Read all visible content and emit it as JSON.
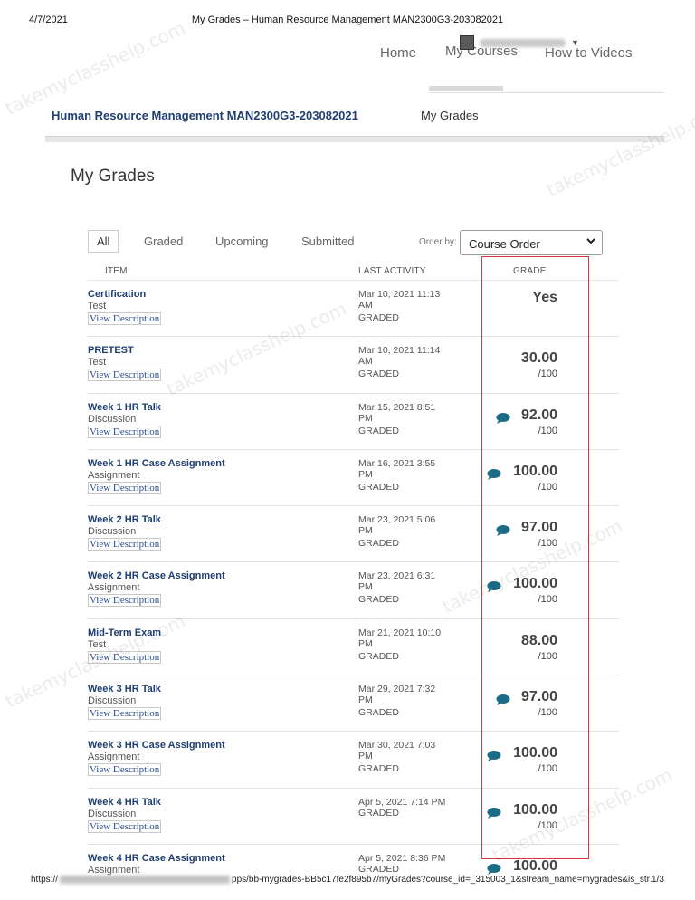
{
  "print_header": {
    "date": "4/7/2021",
    "title": "My Grades – Human Resource Management MAN2300G3-203082021"
  },
  "topnav": {
    "home": "Home",
    "my_courses": "My Courses",
    "how_to_videos": "How to Videos"
  },
  "course": {
    "title": "Human Resource Management MAN2300G3-203082021",
    "breadcrumb": "My Grades"
  },
  "page_title": "My Grades",
  "filters": {
    "all": "All",
    "graded": "Graded",
    "upcoming": "Upcoming",
    "submitted": "Submitted"
  },
  "order_by": {
    "label": "Order by:",
    "selected": "Course Order"
  },
  "columns": {
    "item": "ITEM",
    "last_activity": "LAST ACTIVITY",
    "grade": "GRADE"
  },
  "view_description_label": "View Description",
  "rows": [
    {
      "name": "Certification",
      "type": "Test",
      "date_line1": "Mar 10, 2021 11:13",
      "date_line2": "AM",
      "status": "GRADED",
      "grade": "Yes",
      "max": "",
      "comment": false
    },
    {
      "name": "PRETEST",
      "type": "Test",
      "date_line1": "Mar 10, 2021 11:14",
      "date_line2": "AM",
      "status": "GRADED",
      "grade": "30.00",
      "max": "/100",
      "comment": false
    },
    {
      "name": "Week 1 HR Talk",
      "type": "Discussion",
      "date_line1": "Mar 15, 2021 8:51",
      "date_line2": "PM",
      "status": "GRADED",
      "grade": "92.00",
      "max": "/100",
      "comment": true
    },
    {
      "name": "Week 1 HR Case Assignment",
      "type": "Assignment",
      "date_line1": "Mar 16, 2021 3:55",
      "date_line2": "PM",
      "status": "GRADED",
      "grade": "100.00",
      "max": "/100",
      "comment": true
    },
    {
      "name": "Week 2 HR Talk",
      "type": "Discussion",
      "date_line1": "Mar 23, 2021 5:06",
      "date_line2": "PM",
      "status": "GRADED",
      "grade": "97.00",
      "max": "/100",
      "comment": true
    },
    {
      "name": "Week 2 HR Case Assignment",
      "type": "Assignment",
      "date_line1": "Mar 23, 2021 6:31",
      "date_line2": "PM",
      "status": "GRADED",
      "grade": "100.00",
      "max": "/100",
      "comment": true
    },
    {
      "name": "Mid-Term Exam",
      "type": "Test",
      "date_line1": "Mar 21, 2021 10:10",
      "date_line2": "PM",
      "status": "GRADED",
      "grade": "88.00",
      "max": "/100",
      "comment": false
    },
    {
      "name": "Week 3 HR Talk",
      "type": "Discussion",
      "date_line1": "Mar 29, 2021 7:32",
      "date_line2": "PM",
      "status": "GRADED",
      "grade": "97.00",
      "max": "/100",
      "comment": true
    },
    {
      "name": "Week 3 HR Case Assignment",
      "type": "Assignment",
      "date_line1": "Mar 30, 2021 7:03",
      "date_line2": "PM",
      "status": "GRADED",
      "grade": "100.00",
      "max": "/100",
      "comment": true
    },
    {
      "name": "Week 4 HR Talk",
      "type": "Discussion",
      "date_line1": "Apr 5, 2021 7:14 PM",
      "date_line2": "",
      "status": "GRADED",
      "grade": "100.00",
      "max": "/100",
      "comment": true
    },
    {
      "name": "Week 4 HR Case Assignment",
      "type": "Assignment",
      "date_line1": "Apr 5, 2021 8:36 PM",
      "date_line2": "",
      "status": "GRADED",
      "grade": "100.00",
      "max": "",
      "comment": true
    }
  ],
  "footer": {
    "url_prefix": "https://",
    "url_suffix": "pps/bb-mygrades-BB5c17fe2f895b7/myGrades?course_id=_315003_1&stream_name=mygrades&is_str…",
    "page": "1/3"
  },
  "watermark_text": "takemyclasshelp.com",
  "colors": {
    "link_blue": "#1f3f72",
    "comment_teal": "#1d6c85",
    "highlight_red": "#d9363e"
  },
  "icons": {
    "comment": "comment-bubble-icon",
    "select_caret": "chevron-down-icon"
  }
}
